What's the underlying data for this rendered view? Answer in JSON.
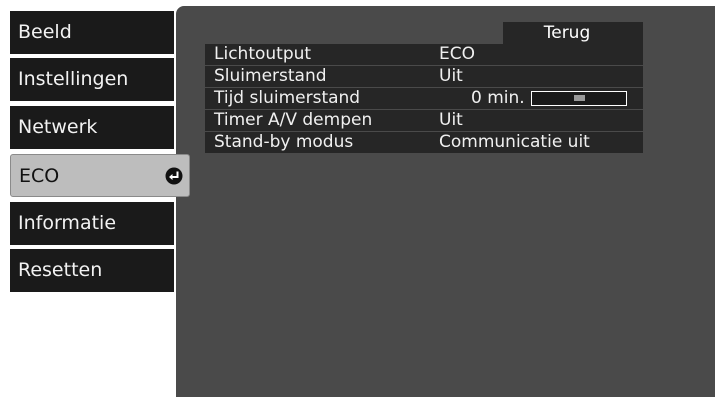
{
  "sidebar": {
    "items": [
      {
        "label": "Beeld"
      },
      {
        "label": "Instellingen"
      },
      {
        "label": "Netwerk"
      },
      {
        "label": "ECO",
        "selected": true
      },
      {
        "label": "Informatie"
      },
      {
        "label": "Resetten"
      }
    ]
  },
  "panel": {
    "back_label": "Terug",
    "rows": [
      {
        "label": "Lichtoutput",
        "value": "ECO"
      },
      {
        "label": "Sluimerstand",
        "value": "Uit"
      },
      {
        "label": "Tijd sluimerstand",
        "value": "0 min.",
        "slider_level": 0.5
      },
      {
        "label": "Timer A/V dempen",
        "value": "Uit"
      },
      {
        "label": "Stand-by modus",
        "value": "Communicatie uit"
      }
    ]
  },
  "colors": {
    "panel_bg": "#4a4a4a",
    "row_bg": "#262626",
    "menu_bg": "#1a1a1a",
    "menu_selected_bg": "#bdbdbd"
  },
  "icons": {
    "selected_item": "enter-icon"
  }
}
